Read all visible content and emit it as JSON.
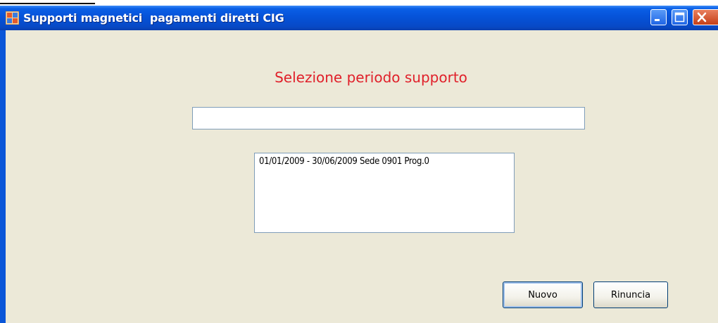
{
  "window": {
    "title": "Supporti magnetici  pagamenti diretti CIG",
    "controls": {
      "minimize": "minimize-icon",
      "maximize": "maximize-icon",
      "close": "close-icon"
    }
  },
  "form": {
    "heading": "Selezione periodo supporto",
    "input_value": "",
    "list_items": [
      "01/01/2009 - 30/06/2009 Sede 0901 Prog.0"
    ],
    "buttons": {
      "nuovo": "Nuovo",
      "rinuncia": "Rinuncia"
    }
  }
}
